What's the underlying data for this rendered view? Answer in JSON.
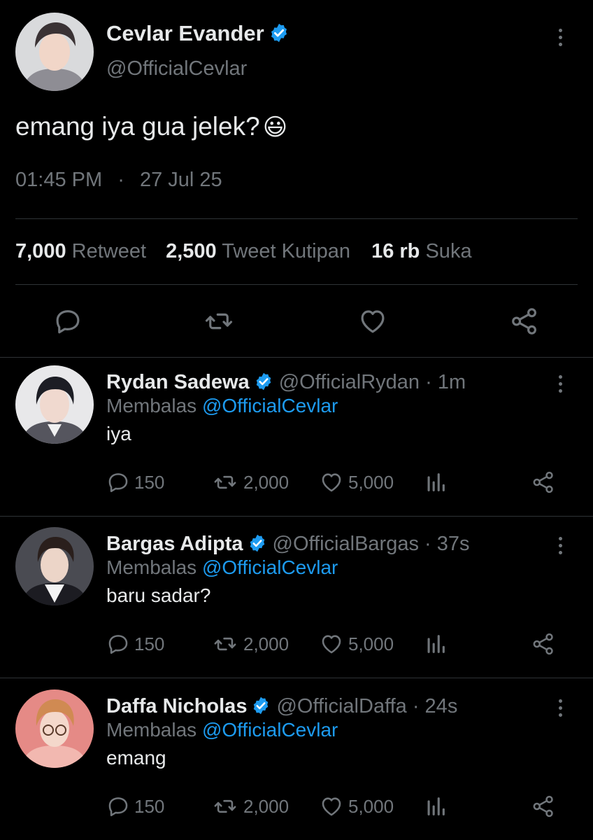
{
  "tweet": {
    "author_name": "Cevlar Evander",
    "author_handle": "@OfficialCevlar",
    "text": "emang iya gua jelek?",
    "emoji": "😃",
    "time": "01:45 PM",
    "separator": "·",
    "date": "27 Jul 25",
    "stats": {
      "retweets_num": "7,000",
      "retweets_label": "Retweet",
      "quotes_num": "2,500",
      "quotes_label": "Tweet Kutipan",
      "likes_num": "16 rb",
      "likes_label": "Suka"
    }
  },
  "replies": [
    {
      "name": "Rydan Sadewa",
      "handle": "@OfficialRydan · 1m",
      "replying_prefix": "Membalas",
      "replying_to": "@OfficialCevlar",
      "text": "iya",
      "replies": "150",
      "retweets": "2,000",
      "likes": "5,000"
    },
    {
      "name": "Bargas Adipta",
      "handle": "@OfficialBargas · 37s",
      "replying_prefix": "Membalas",
      "replying_to": "@OfficialCevlar",
      "text": "baru sadar?",
      "replies": "150",
      "retweets": "2,000",
      "likes": "5,000"
    },
    {
      "name": "Daffa Nicholas",
      "handle": "@OfficialDaffa · 24s",
      "replying_prefix": "Membalas",
      "replying_to": "@OfficialCevlar",
      "text": "emang",
      "replies": "150",
      "retweets": "2,000",
      "likes": "5,000"
    }
  ],
  "colors": {
    "background": "#000000",
    "text_primary": "#e7e9ea",
    "text_secondary": "#71767b",
    "accent": "#1d9bf0",
    "divider": "#2f3336"
  },
  "icons": [
    "verified-badge-icon",
    "more-options-icon",
    "reply-icon",
    "retweet-icon",
    "like-icon",
    "analytics-icon",
    "share-icon"
  ]
}
